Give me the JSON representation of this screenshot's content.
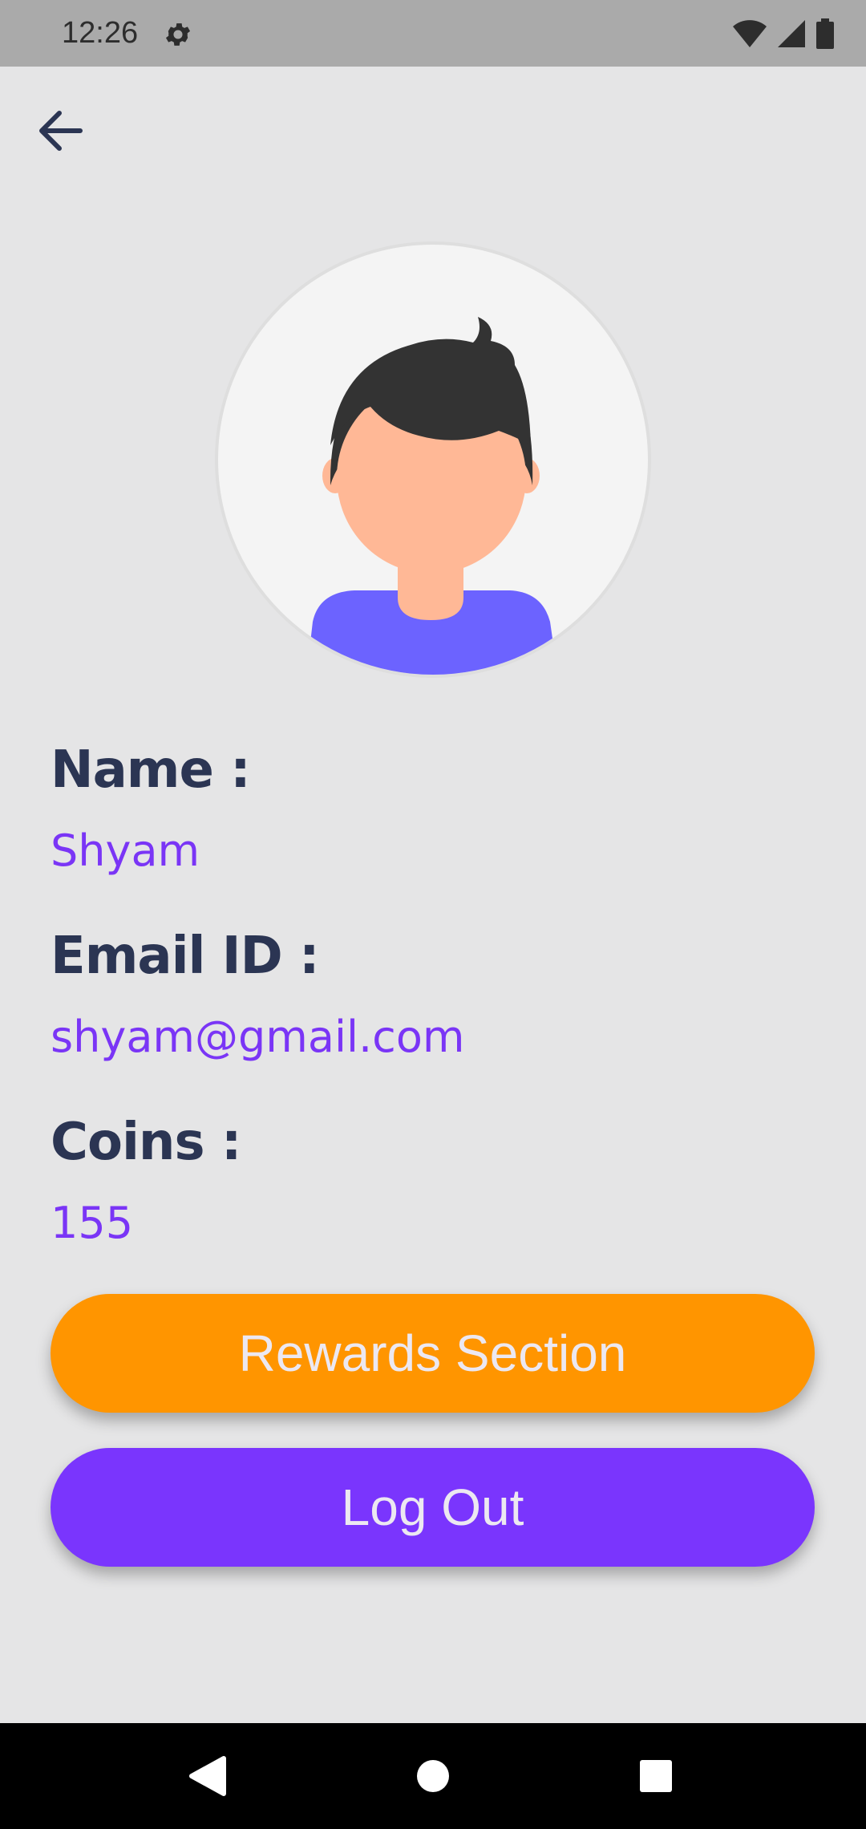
{
  "status_bar": {
    "time": "12:26",
    "icons": [
      "gear-icon",
      "wifi-icon",
      "signal-icon",
      "battery-icon"
    ]
  },
  "header": {
    "back_icon": "arrow-left-icon"
  },
  "profile": {
    "avatar_icon": "user-avatar-illustration",
    "fields": [
      {
        "label": "Name :",
        "value": "Shyam"
      },
      {
        "label": "Email ID :",
        "value": "shyam@gmail.com"
      },
      {
        "label": "Coins :",
        "value": "155"
      }
    ]
  },
  "actions": {
    "rewards_label": "Rewards Section",
    "logout_label": "Log Out"
  },
  "nav_bar": {
    "icons": [
      "back-triangle-icon",
      "home-circle-icon",
      "recents-square-icon"
    ]
  },
  "colors": {
    "label": "#2b3553",
    "value": "#7a35f6",
    "rewards_button": "#ff9500",
    "logout_button": "#7a35fd",
    "background": "#e5e5e6"
  }
}
